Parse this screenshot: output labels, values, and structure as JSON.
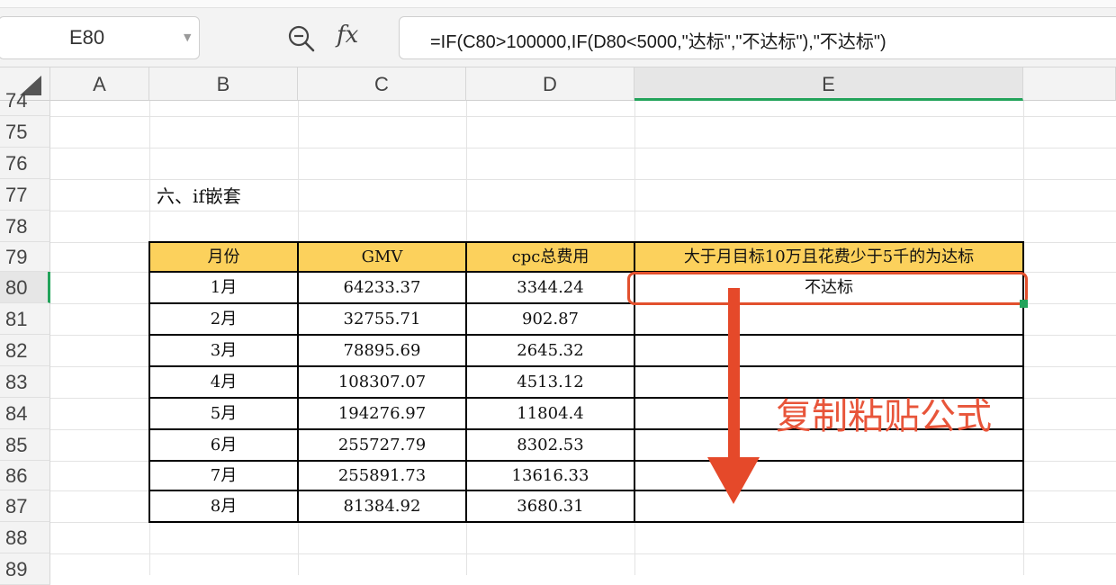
{
  "toolbar": {
    "name_box": "E80",
    "formula": "=IF(C80>100000,IF(D80<5000,\"达标\",\"不达标\"),\"不达标\")"
  },
  "columns": [
    "A",
    "B",
    "C",
    "D",
    "E"
  ],
  "rows": [
    "74",
    "75",
    "76",
    "77",
    "78",
    "79",
    "80",
    "81",
    "82",
    "83",
    "84",
    "85",
    "86",
    "87",
    "88",
    "89"
  ],
  "section_title": "六、if嵌套",
  "table": {
    "headers": [
      "月份",
      "GMV",
      "cpc总费用",
      "大于月目标10万且花费少于5千的为达标"
    ],
    "rows": [
      [
        "1月",
        "64233.37",
        "3344.24",
        "不达标"
      ],
      [
        "2月",
        "32755.71",
        "902.87",
        ""
      ],
      [
        "3月",
        "78895.69",
        "2645.32",
        ""
      ],
      [
        "4月",
        "108307.07",
        "4513.12",
        ""
      ],
      [
        "5月",
        "194276.97",
        "11804.4",
        ""
      ],
      [
        "6月",
        "255727.79",
        "8302.53",
        ""
      ],
      [
        "7月",
        "255891.73",
        "13616.33",
        ""
      ],
      [
        "8月",
        "81384.92",
        "3680.31",
        ""
      ]
    ]
  },
  "annotation": "复制粘贴公式",
  "colors": {
    "header_fill": "#fcd15c",
    "selection_accent": "#22a35a",
    "annotation_red": "#e8553a"
  }
}
